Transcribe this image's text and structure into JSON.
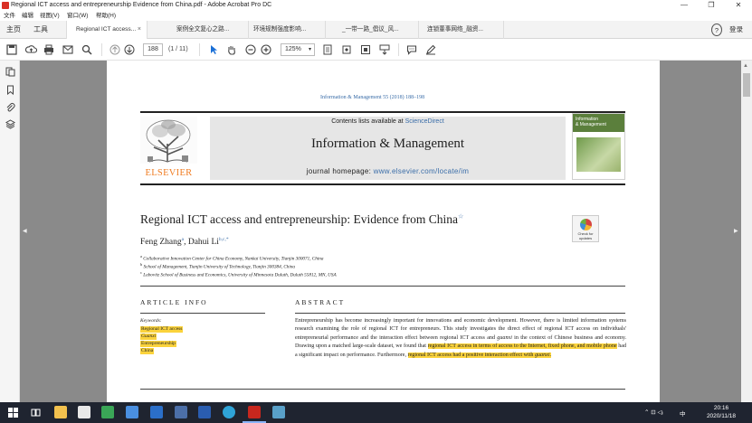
{
  "window": {
    "title": "Regional ICT access and entrepreneurship Evidence from China.pdf - Adobe Acrobat Pro DC",
    "minimize": "—",
    "restore": "❐",
    "close": "✕"
  },
  "menu": [
    "文件",
    "编辑",
    "视图(V)",
    "窗口(W)",
    "帮助(H)"
  ],
  "tabs": {
    "home": "主页",
    "tools": "工具",
    "docs": [
      {
        "label": "Regional ICT access...",
        "active": true
      },
      {
        "label": "案例全文复心之路..."
      },
      {
        "label": "环境规制强度影响..."
      },
      {
        "label": "_一带一路_倡议_风..."
      },
      {
        "label": "连锁董事网络_融资..."
      }
    ],
    "close_glyph": "×",
    "help": "?",
    "login": "登录"
  },
  "toolbar": {
    "page_number": "188",
    "page_count": "(1 / 11)",
    "zoom": "125%",
    "zoom_arrow": "▾"
  },
  "paper": {
    "journal_ref": "Information & Management 55 (2018) 188–198",
    "contents_prefix": "Contents lists available at",
    "sciencedirect": "ScienceDirect",
    "journal_name": "Information & Management",
    "homepage_prefix": "journal homepage:",
    "homepage_url": "www.elsevier.com/locate/im",
    "publisher": "ELSEVIER",
    "cover_title": "Information\n& Management",
    "title": "Regional ICT access and entrepreneurship: Evidence from China",
    "title_mark": "☆",
    "check_updates": "Check for updates",
    "author1": "Feng Zhang",
    "author1_sup": "a",
    "author_sep": ", ",
    "author2": "Dahui Li",
    "author2_sup": "b,c,*",
    "affiliations": [
      {
        "sup": "a",
        "text": "Collaborative Innovation Center for China Economy, Nankai University, Tianjin 300071, China"
      },
      {
        "sup": "b",
        "text": "School of Management, Tianjin University of Technology, Tianjin 300384, China"
      },
      {
        "sup": "c",
        "text": "Labovitz School of Business and Economics, University of Minnesota Duluth, Duluth 55812, MN, USA"
      }
    ],
    "article_info_head": "ARTICLE INFO",
    "abstract_head": "ABSTRACT",
    "keywords_label": "Keywords:",
    "keywords": [
      "Regional ICT access",
      "Guanxi",
      "Entrepreneurship",
      "China"
    ],
    "abstract_parts": [
      {
        "text": "Entrepreneurship has become increasingly important for innovations and economic development. However, there is limited information systems research examining the role of regional ICT for entrepreneurs. This study investigates the direct effect of regional ICT access on individuals' entrepreneurial performance and the interaction effect between regional ICT access and ",
        "hl": false
      },
      {
        "text": "guanxi",
        "hl": false,
        "it": true
      },
      {
        "text": " in the context of Chinese business and economy. Drawing upon a matched large-scale dataset, we found that ",
        "hl": false
      },
      {
        "text": "regional ICT access in terms of access to the Internet, fixed phone, and mobile phone",
        "hl": true
      },
      {
        "text": " had a significant impact on performance. Furthermore, ",
        "hl": false
      },
      {
        "text": "regional ICT access had a positive interaction effect with ",
        "hl": true
      },
      {
        "text": "guanxi",
        "hl": true,
        "it": true
      },
      {
        "text": ".",
        "hl": true
      }
    ]
  },
  "taskbar": {
    "time": "20:16",
    "date": "2020/11/18",
    "lang": "中",
    "tray": "⌃ ⊡ ◁ᵢ"
  }
}
